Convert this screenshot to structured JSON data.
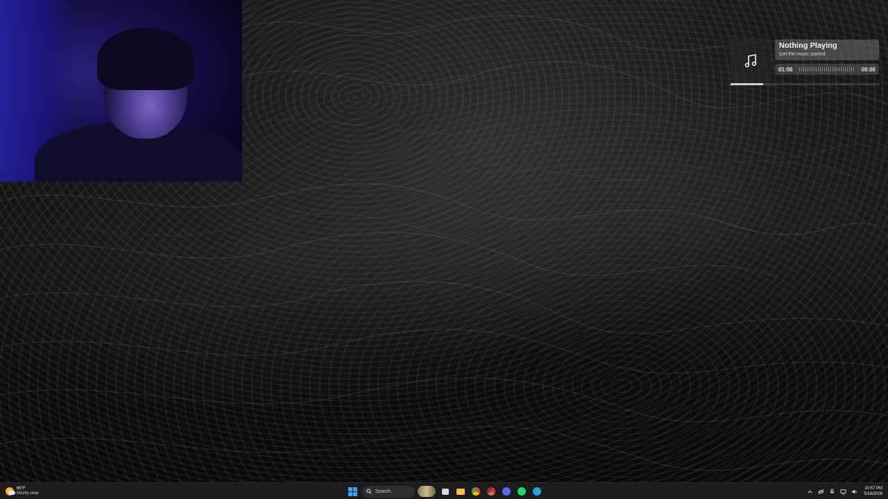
{
  "media_player": {
    "title": "Nothing Playing",
    "subtitle": "Get the music started",
    "elapsed": "01:06",
    "duration": "00:00",
    "progress_fraction": 0.22,
    "icon": "music-note-icon"
  },
  "taskbar": {
    "weather": {
      "temp": "65°F",
      "condition": "Mostly clear",
      "icon": "partly-cloudy-night-icon"
    },
    "search_label": "Search",
    "pinned_apps": [
      "file-explorer-icon",
      "files-folder-icon",
      "chrome-icon",
      "chrome-alt-icon",
      "discord-icon",
      "spotify-icon",
      "steam-icon"
    ],
    "clock": {
      "time": "10:57 PM",
      "date": "5/18/2026"
    },
    "accent": "#3aa0ff"
  }
}
